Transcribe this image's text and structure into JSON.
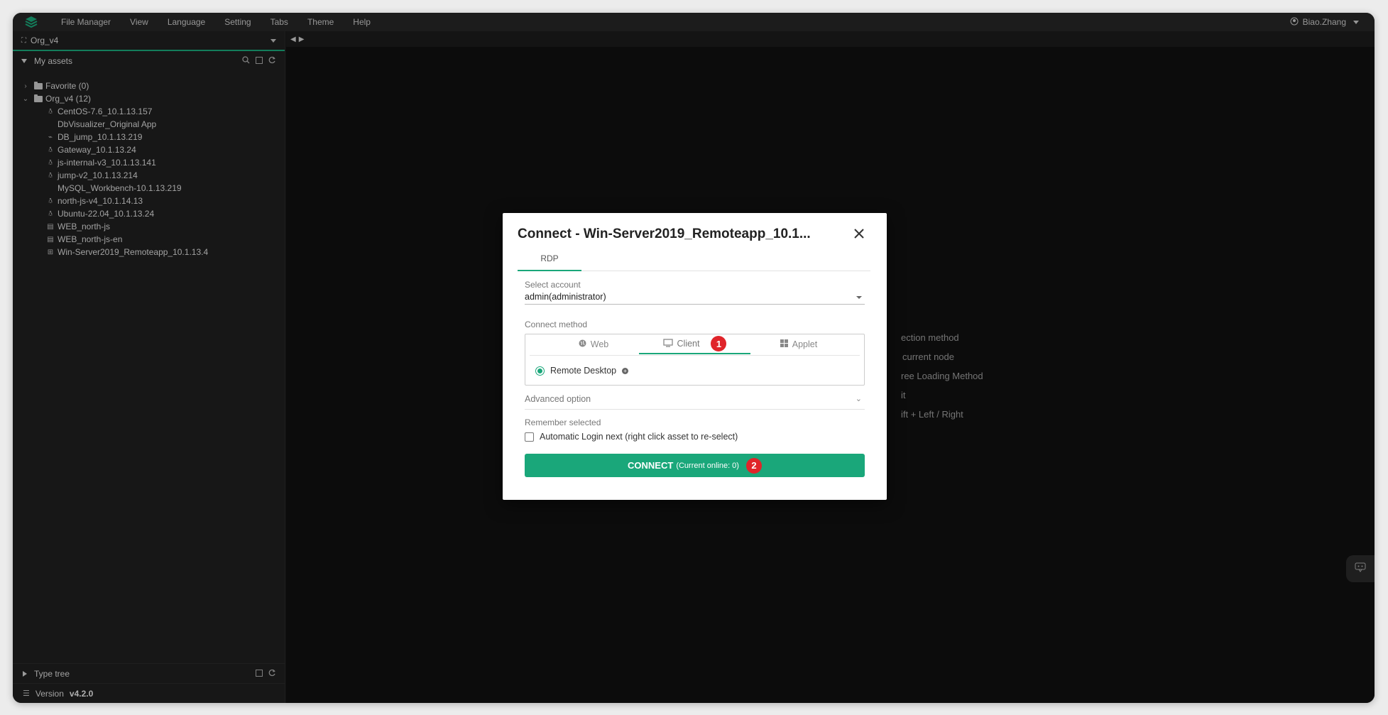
{
  "menubar": {
    "items": [
      "File Manager",
      "View",
      "Language",
      "Setting",
      "Tabs",
      "Theme",
      "Help"
    ],
    "user": "Biao.Zhang"
  },
  "sidebar": {
    "org": "Org_v4",
    "assets_header": "My assets",
    "tree": [
      {
        "label": "Favorite (0)",
        "type": "folder",
        "level": 0,
        "expanded": false
      },
      {
        "label": "Org_v4 (12)",
        "type": "folder",
        "level": 0,
        "expanded": true
      },
      {
        "label": "CentOS-7.6_10.1.13.157",
        "type": "linux",
        "level": 1
      },
      {
        "label": "DbVisualizer_Original App",
        "type": "app",
        "level": 1
      },
      {
        "label": "DB_jump_10.1.13.219",
        "type": "db",
        "level": 1
      },
      {
        "label": "Gateway_10.1.13.24",
        "type": "linux",
        "level": 1
      },
      {
        "label": "js-internal-v3_10.1.13.141",
        "type": "linux",
        "level": 1
      },
      {
        "label": "jump-v2_10.1.13.214",
        "type": "linux",
        "level": 1
      },
      {
        "label": "MySQL_Workbench-10.1.13.219",
        "type": "app",
        "level": 1
      },
      {
        "label": "north-js-v4_10.1.14.13",
        "type": "linux",
        "level": 1
      },
      {
        "label": "Ubuntu-22.04_10.1.13.24",
        "type": "linux",
        "level": 1
      },
      {
        "label": "WEB_north-js",
        "type": "web",
        "level": 1
      },
      {
        "label": "WEB_north-js-en",
        "type": "web",
        "level": 1
      },
      {
        "label": "Win-Server2019_Remoteapp_10.1.13.4",
        "type": "windows",
        "level": 1
      }
    ],
    "type_tree": "Type tree",
    "version_label": "Version",
    "version_value": "v4.2.0"
  },
  "background_tips": [
    "ection method",
    "current node",
    "ree Loading Method",
    "it",
    "ift + Left / Right"
  ],
  "modal": {
    "title": "Connect - Win-Server2019_Remoteapp_10.1...",
    "protocol_tab": "RDP",
    "select_account_label": "Select account",
    "account_value": "admin(administrator)",
    "connect_method_label": "Connect method",
    "methods": [
      {
        "label": "Web",
        "icon": "globe-icon",
        "active": false
      },
      {
        "label": "Client",
        "icon": "monitor-icon",
        "active": true,
        "badge": "1"
      },
      {
        "label": "Applet",
        "icon": "windows-icon",
        "active": false
      }
    ],
    "client_option": "Remote Desktop",
    "advanced_option": "Advanced option",
    "remember_label": "Remember selected",
    "auto_login_label": "Automatic Login next (right click asset to re-select)",
    "connect_button": "CONNECT",
    "connect_online": "(Current online: 0)",
    "connect_badge": "2",
    "colors": {
      "accent": "#1aa77a",
      "badge": "#e0242a"
    }
  }
}
